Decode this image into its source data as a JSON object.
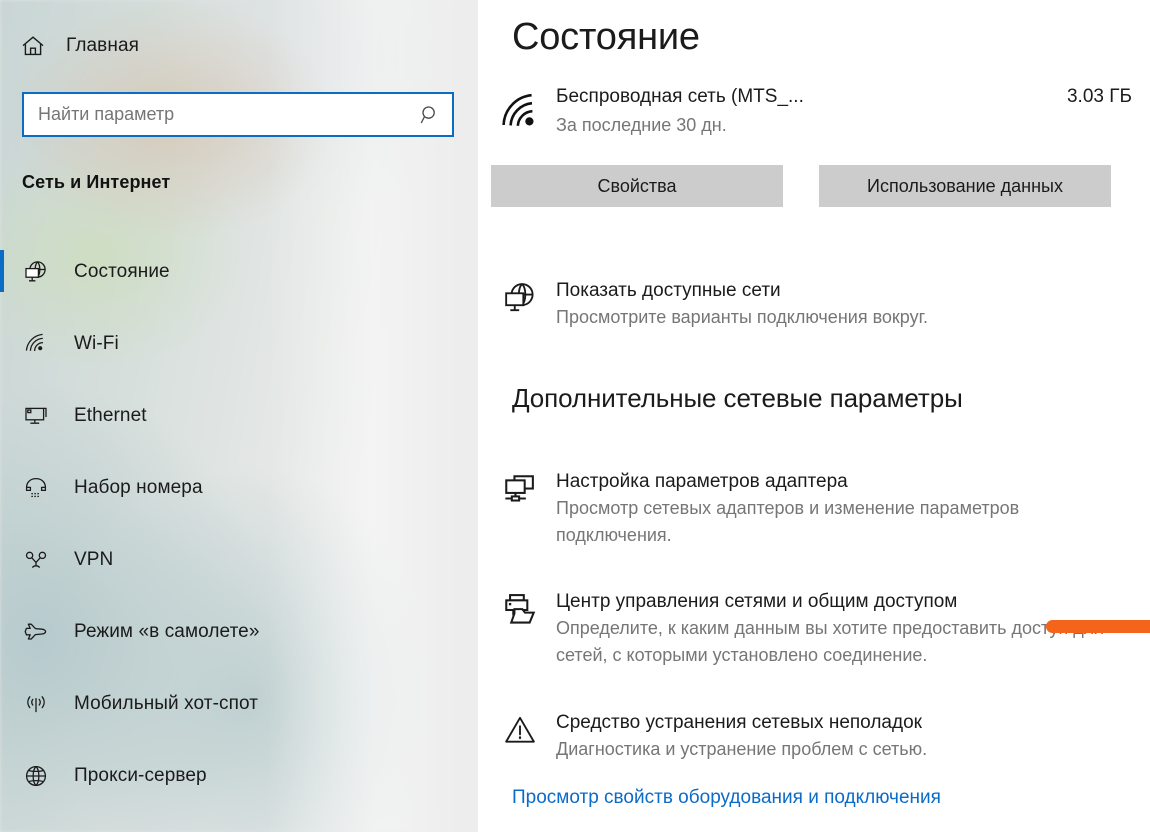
{
  "sidebar": {
    "home": {
      "label": "Главная",
      "icon": "home-icon"
    },
    "search": {
      "placeholder": "Найти параметр",
      "value": "",
      "icon": "search-icon"
    },
    "category_heading": "Сеть и Интернет",
    "items": [
      {
        "label": "Состояние",
        "icon": "network-status-icon",
        "selected": true
      },
      {
        "label": "Wi-Fi",
        "icon": "wifi-icon",
        "selected": false
      },
      {
        "label": "Ethernet",
        "icon": "ethernet-icon",
        "selected": false
      },
      {
        "label": "Набор номера",
        "icon": "dial-up-icon",
        "selected": false
      },
      {
        "label": "VPN",
        "icon": "vpn-icon",
        "selected": false
      },
      {
        "label": "Режим «в самолете»",
        "icon": "airplane-icon",
        "selected": false
      },
      {
        "label": "Мобильный хот-спот",
        "icon": "hotspot-icon",
        "selected": false
      },
      {
        "label": "Прокси-сервер",
        "icon": "globe-icon",
        "selected": false
      }
    ],
    "accent_color": "#0a6cc4"
  },
  "main": {
    "title": "Состояние",
    "connection": {
      "icon": "wifi-signal-icon",
      "name": "Беспроводная сеть (MTS_...",
      "subtitle": "За последние 30 дн.",
      "usage": "3.03 ГБ"
    },
    "buttons": [
      {
        "label": "Свойства"
      },
      {
        "label": "Использование данных"
      }
    ],
    "show_networks": {
      "icon": "network-status-icon",
      "title": "Показать доступные сети",
      "desc": "Просмотрите варианты подключения вокруг."
    },
    "section_heading": "Дополнительные сетевые параметры",
    "entries": [
      {
        "icon": "adapter-icon",
        "title": "Настройка параметров адаптера",
        "desc": "Просмотр сетевых адаптеров и изменение параметров подключения."
      },
      {
        "icon": "sharing-center-icon",
        "title": "Центр управления сетями и общим доступом",
        "desc": "Определите, к каким данным вы хотите предоставить доступ для сетей, с которыми установлено соединение."
      },
      {
        "icon": "warning-triangle-icon",
        "title": "Средство устранения сетевых неполадок",
        "desc": "Диагностика и устранение проблем с сетью."
      }
    ],
    "link": "Просмотр свойств оборудования и подключения",
    "link_color": "#0b6bc8"
  },
  "annotation": {
    "type": "marker-underline",
    "color": "#f4641a",
    "target": "Центр управления сетями и общим доступом"
  }
}
